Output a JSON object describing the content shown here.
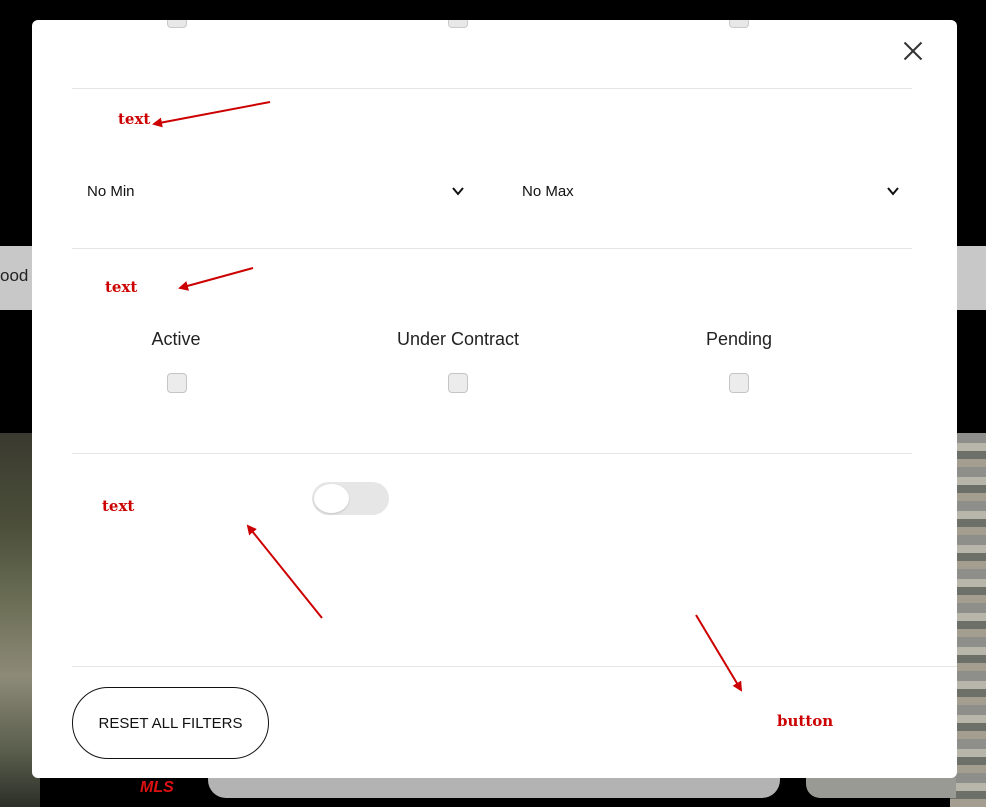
{
  "background": {
    "strip_text": "ood",
    "mls_logo": "MLS"
  },
  "modal": {
    "price": {
      "annotation": "text",
      "min_select": {
        "value": "No Min"
      },
      "max_select": {
        "value": "No Max"
      }
    },
    "status": {
      "annotation": "text",
      "options": [
        {
          "label": "Active",
          "checked": false
        },
        {
          "label": "Under Contract",
          "checked": false
        },
        {
          "label": "Pending",
          "checked": false
        }
      ]
    },
    "toggle_section": {
      "annotation": "text",
      "toggle_on": false
    },
    "footer": {
      "reset_label": "RESET ALL FILTERS",
      "button_annotation": "button"
    }
  },
  "colors": {
    "annotation": "#cc0000",
    "overlay": "#000000",
    "checkbox_fill": "#ececec"
  }
}
